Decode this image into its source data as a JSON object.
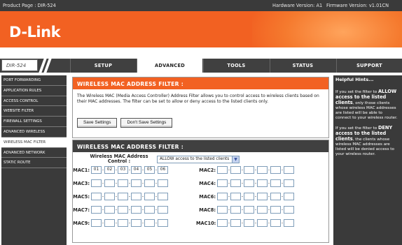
{
  "header": {
    "product_page": "Product Page : DIR-524",
    "hardware_version": "Hardware Version: A1",
    "firmware_version": "Firmware Version: v1.01CN"
  },
  "logo": "D-Link",
  "model": "DIR-524",
  "nav": {
    "tabs": [
      "SETUP",
      "ADVANCED",
      "TOOLS",
      "STATUS",
      "SUPPORT"
    ],
    "active": "ADVANCED"
  },
  "sidebar": {
    "items": [
      "PORT FORWARDING",
      "APPLICATION RULES",
      "ACCESS CONTROL",
      "WEBSITE FILTER",
      "FIREWALL SETTINGS",
      "ADVANCED WIRELESS",
      "WIRELESS MAC FILTER",
      "ADVANCED NETWORK",
      "STATIC ROUTE"
    ],
    "active": "WIRELESS MAC FILTER"
  },
  "filter_section": {
    "title": "WIRELESS MAC ADDRESS FILTER :",
    "description": "The Wireless MAC (Media Access Controller) Address Filter allows you to control access to wireless clients based on their MAC addresses. The filter can be set to allow or deny access to the listed clients only.",
    "save_label": "Save Settings",
    "dont_save_label": "Don't Save Settings"
  },
  "filter_table": {
    "title": "WIRELESS MAC ADDRESS FILTER :",
    "control_label": "Wireless MAC Address Control :",
    "control_value": "ALLOW access to the listed clients",
    "macs": [
      {
        "label": "MAC1:",
        "octets": [
          "01",
          "02",
          "03",
          "04",
          "05",
          "06"
        ]
      },
      {
        "label": "MAC2:",
        "octets": [
          "",
          "",
          "",
          "",
          "",
          ""
        ]
      },
      {
        "label": "MAC3:",
        "octets": [
          "",
          "",
          "",
          "",
          "",
          ""
        ]
      },
      {
        "label": "MAC4:",
        "octets": [
          "",
          "",
          "",
          "",
          "",
          ""
        ]
      },
      {
        "label": "MAC5:",
        "octets": [
          "",
          "",
          "",
          "",
          "",
          ""
        ]
      },
      {
        "label": "MAC6:",
        "octets": [
          "",
          "",
          "",
          "",
          "",
          ""
        ]
      },
      {
        "label": "MAC7:",
        "octets": [
          "",
          "",
          "",
          "",
          "",
          ""
        ]
      },
      {
        "label": "MAC8:",
        "octets": [
          "",
          "",
          "",
          "",
          "",
          ""
        ]
      },
      {
        "label": "MAC9:",
        "octets": [
          "",
          "",
          "",
          "",
          "",
          ""
        ]
      },
      {
        "label": "MAC10:",
        "octets": [
          "",
          "",
          "",
          "",
          "",
          ""
        ]
      }
    ],
    "separator": "-"
  },
  "hints": {
    "title": "Helpful Hints...",
    "allow_intro": "If you set the filter to",
    "allow_bold": "ALLOW access to the listed clients",
    "allow_rest": ", only those clients whose wireless MAC addresses are listed will be able to connect to your wireless router.",
    "deny_intro": "If you set the filter to",
    "deny_bold": "DENY access to the listed clients",
    "deny_rest": ", the clients whose wireless MAC addresses are listed will be denied access to your wireless router."
  },
  "colors": {
    "brand_orange": "#f26122",
    "dark_bar": "#3a3a3a",
    "nav_bar": "#404040"
  }
}
